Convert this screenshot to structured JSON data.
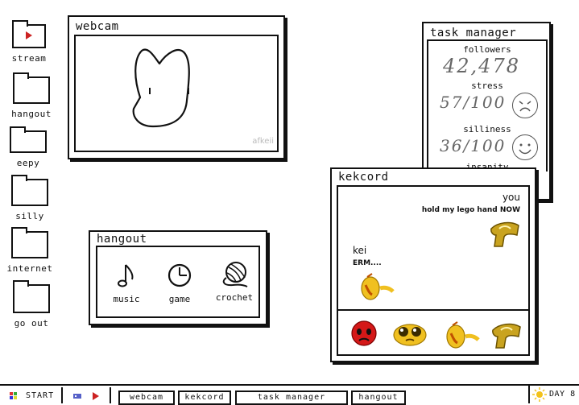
{
  "desktop": {
    "icons": [
      {
        "label": "stream"
      },
      {
        "label": "hangout"
      },
      {
        "label": "eepy"
      },
      {
        "label": "silly"
      },
      {
        "label": "internet"
      },
      {
        "label": "go out"
      }
    ]
  },
  "webcam": {
    "title": "webcam",
    "watermark": "afkeii"
  },
  "hangout_window": {
    "title": "hangout",
    "apps": [
      {
        "label": "music",
        "icon": "music-note-icon"
      },
      {
        "label": "game",
        "icon": "clock-icon"
      },
      {
        "label": "crochet",
        "icon": "yarn-ball-icon"
      }
    ]
  },
  "task_manager": {
    "title": "task manager",
    "stats": [
      {
        "label": "followers",
        "value": "42,478"
      },
      {
        "label": "stress",
        "value": "57/100"
      },
      {
        "label": "silliness",
        "value": "36/100"
      },
      {
        "label": "insanity",
        "value": ""
      }
    ]
  },
  "kekcord": {
    "title": "kekcord",
    "messages": [
      {
        "sender": "you",
        "text": "hold my lego hand NOW"
      },
      {
        "sender": "kei",
        "text": "ERM...."
      }
    ],
    "emojis": [
      "angry-emoji-icon",
      "pleading-emoji-icon",
      "saluting-emoji-icon",
      "lego-hand-emoji-icon"
    ]
  },
  "taskbar": {
    "start_label": "START",
    "windows": [
      "webcam",
      "kekcord",
      "task manager",
      "hangout"
    ],
    "day_label": "DAY 8"
  },
  "colors": {
    "ink": "#111111",
    "play_red": "#cc2222",
    "sun_yellow": "#f2c21b",
    "emoji_yellow": "#f0c020",
    "emoji_red": "#d41818"
  }
}
